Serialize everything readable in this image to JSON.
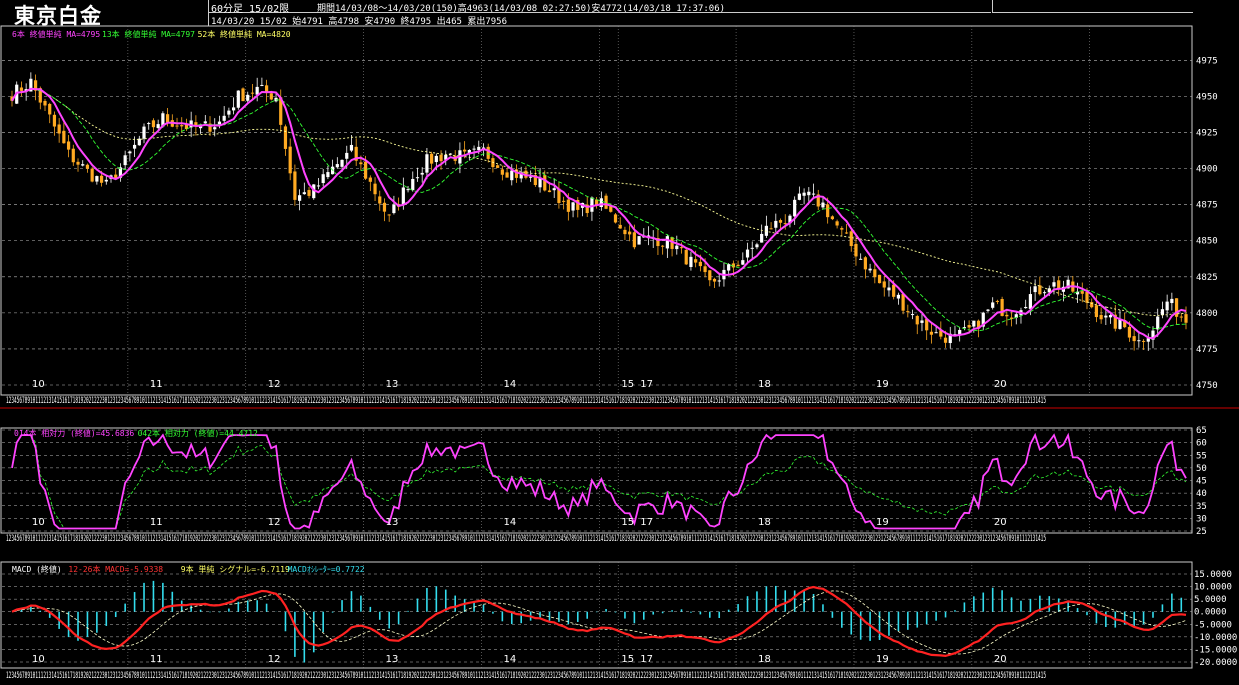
{
  "header": {
    "title": "東京白金",
    "period_type": "60分足 15/02限",
    "period_info": "期間14/03/08～14/03/20(150)高4963(14/03/08 02:27:50)安4772(14/03/18 17:37:06)",
    "ohlc_info": "14/03/20 15/02 始4791 高4798 安4790 終4795 出465 累出7956"
  },
  "price_panel": {
    "legend": [
      {
        "text": "6本 終値単純 MA=4795",
        "color": "#ff44ff"
      },
      {
        "text": "13本 終値単純 MA=4797",
        "color": "#33ff33"
      },
      {
        "text": "52本 終値単純 MA=4820",
        "color": "#ffff66"
      }
    ],
    "y_ticks": [
      "4975",
      "4950",
      "4925",
      "4900",
      "4875",
      "4850",
      "4825",
      "4800",
      "4775",
      "4750"
    ]
  },
  "rsi_panel": {
    "legend": [
      {
        "text": "014本 相対力 (終値)=45.6836",
        "color": "#ff44ff"
      },
      {
        "text": "042本 相対力 (終値)=44.4712",
        "color": "#33ff33"
      }
    ],
    "y_ticks": [
      "65",
      "60",
      "55",
      "50",
      "45",
      "40",
      "35",
      "30",
      "25"
    ]
  },
  "macd_panel": {
    "legend": [
      {
        "text": "MACD (終値)",
        "color": "#ffffff"
      },
      {
        "text": "12-26本 MACD=-5.9338",
        "color": "#ff3333"
      },
      {
        "text": "9本 単純 シグナル=-6.7119",
        "color": "#ffff66"
      },
      {
        "text": "MACDｵｼﾚｰﾀｰ=0.7722",
        "color": "#33ddee"
      }
    ],
    "y_ticks": [
      "15.0000",
      "10.0000",
      "5.0000",
      "0.0000",
      "-5.0000",
      "-10.0000",
      "-15.0000",
      "-20.0000"
    ]
  },
  "x_axis": {
    "day_labels": [
      "10",
      "11",
      "12",
      "13",
      "14",
      "15",
      "17",
      "18",
      "19",
      "20"
    ],
    "hour_label_pattern": "12345678910111213141516171819202122230123"
  },
  "colors": {
    "up_candle": "#ffffff",
    "down_candle": "#ffaa22",
    "ma_short": "#ff44ff",
    "ma_mid": "#33ff33",
    "ma_long": "#ffff99",
    "macd": "#ff2222",
    "signal": "#ffffcc",
    "histogram": "#33ddee",
    "grid": "#bbbbbb"
  },
  "chart_data": [
    {
      "type": "candlestick",
      "panel": "price",
      "ylim": [
        4750,
        4985
      ],
      "y_ticks": [
        4975,
        4950,
        4925,
        4900,
        4875,
        4850,
        4825,
        4800,
        4775,
        4750
      ],
      "anchors_close": [
        [
          0,
          4952
        ],
        [
          4,
          4960
        ],
        [
          8,
          4935
        ],
        [
          12,
          4910
        ],
        [
          16,
          4898
        ],
        [
          20,
          4888
        ],
        [
          24,
          4905
        ],
        [
          28,
          4925
        ],
        [
          32,
          4935
        ],
        [
          36,
          4930
        ],
        [
          40,
          4928
        ],
        [
          44,
          4932
        ],
        [
          48,
          4950
        ],
        [
          52,
          4955
        ],
        [
          56,
          4950
        ],
        [
          60,
          4880
        ],
        [
          64,
          4885
        ],
        [
          68,
          4900
        ],
        [
          72,
          4912
        ],
        [
          76,
          4890
        ],
        [
          80,
          4865
        ],
        [
          84,
          4890
        ],
        [
          88,
          4905
        ],
        [
          92,
          4910
        ],
        [
          96,
          4908
        ],
        [
          100,
          4912
        ],
        [
          104,
          4900
        ],
        [
          108,
          4895
        ],
        [
          112,
          4890
        ],
        [
          116,
          4880
        ],
        [
          120,
          4870
        ],
        [
          124,
          4878
        ],
        [
          128,
          4865
        ],
        [
          132,
          4850
        ],
        [
          136,
          4852
        ],
        [
          140,
          4848
        ],
        [
          144,
          4835
        ],
        [
          148,
          4820
        ],
        [
          152,
          4830
        ],
        [
          156,
          4840
        ],
        [
          160,
          4858
        ],
        [
          164,
          4865
        ],
        [
          168,
          4882
        ],
        [
          172,
          4875
        ],
        [
          176,
          4855
        ],
        [
          180,
          4838
        ],
        [
          184,
          4820
        ],
        [
          188,
          4810
        ],
        [
          192,
          4795
        ],
        [
          196,
          4785
        ],
        [
          200,
          4782
        ],
        [
          204,
          4790
        ],
        [
          208,
          4805
        ],
        [
          212,
          4800
        ],
        [
          216,
          4812
        ],
        [
          220,
          4820
        ],
        [
          224,
          4818
        ],
        [
          228,
          4808
        ],
        [
          232,
          4795
        ],
        [
          236,
          4790
        ],
        [
          239,
          4780
        ],
        [
          242,
          4790
        ],
        [
          245,
          4808
        ],
        [
          249,
          4795
        ]
      ],
      "series": [
        {
          "name": "6本 終値単純 MA",
          "last": 4795
        },
        {
          "name": "13本 終値単純 MA",
          "last": 4797
        },
        {
          "name": "52本 終値単純 MA",
          "last": 4820
        }
      ]
    },
    {
      "type": "line",
      "panel": "rsi",
      "ylim": [
        25,
        65
      ],
      "y_ticks": [
        65,
        60,
        55,
        50,
        45,
        40,
        35,
        30,
        25
      ],
      "series": [
        {
          "name": "014本 相対力 (終値)",
          "last": 45.6836
        },
        {
          "name": "042本 相対力 (終値)",
          "last": 44.4712
        }
      ]
    },
    {
      "type": "line",
      "panel": "macd",
      "ylim": [
        -20,
        15
      ],
      "y_ticks": [
        15,
        10,
        5,
        0,
        -5,
        -10,
        -15,
        -20
      ],
      "series": [
        {
          "name": "12-26本 MACD",
          "last": -5.9338
        },
        {
          "name": "9本 単純 シグナル",
          "last": -6.7119
        },
        {
          "name": "MACDｵｼﾚｰﾀｰ",
          "last": 0.7722
        }
      ]
    }
  ]
}
